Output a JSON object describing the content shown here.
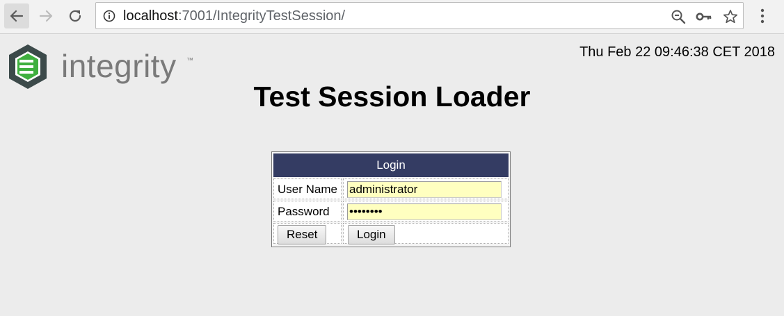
{
  "browser": {
    "url_host": "localhost",
    "url_path": ":7001/IntegrityTestSession/",
    "icons": [
      "back-arrow-icon",
      "forward-arrow-icon",
      "reload-icon",
      "info-icon",
      "zoom-out-icon",
      "key-icon",
      "star-icon",
      "menu-icon"
    ]
  },
  "header": {
    "logo_text": "integrity",
    "logo_tm": "™",
    "datetime": "Thu Feb 22 09:46:38 CET 2018",
    "title": "Test Session Loader"
  },
  "login": {
    "heading": "Login",
    "username_label": "User Name",
    "username_value": "administrator",
    "password_label": "Password",
    "password_value": "••••••••",
    "reset_label": "Reset",
    "login_label": "Login"
  },
  "colors": {
    "header_bg": "#343c63",
    "input_bg": "#ffffc0",
    "page_bg": "#ececec",
    "logo_green": "#3faf3f",
    "logo_dark": "#3c4a4a"
  }
}
